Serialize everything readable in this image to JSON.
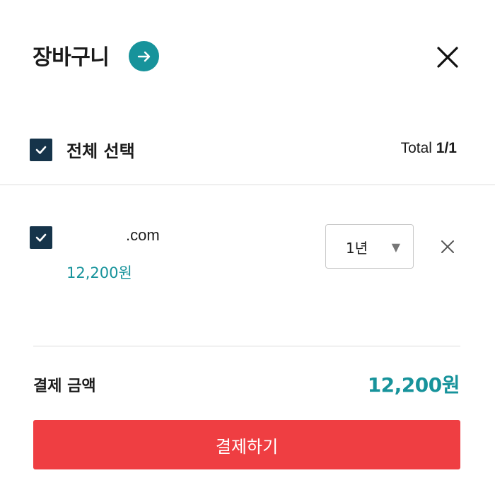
{
  "header": {
    "title": "장바구니",
    "arrow_icon": "arrow-right-icon",
    "close_icon": "close-icon"
  },
  "select_all": {
    "label": "전체 선택",
    "checked": true,
    "total_prefix": "Total ",
    "total_count": "1/1"
  },
  "cart": {
    "items": [
      {
        "domain": ".com",
        "price": "12,200원",
        "checked": true,
        "period": "1년",
        "remove_icon": "close-icon"
      }
    ]
  },
  "summary": {
    "label": "결제 금액",
    "amount": "12,200원"
  },
  "checkout": {
    "label": "결제하기"
  },
  "colors": {
    "accent": "#17939b",
    "checkbox": "#16344a",
    "checkout": "#ef3e42"
  }
}
